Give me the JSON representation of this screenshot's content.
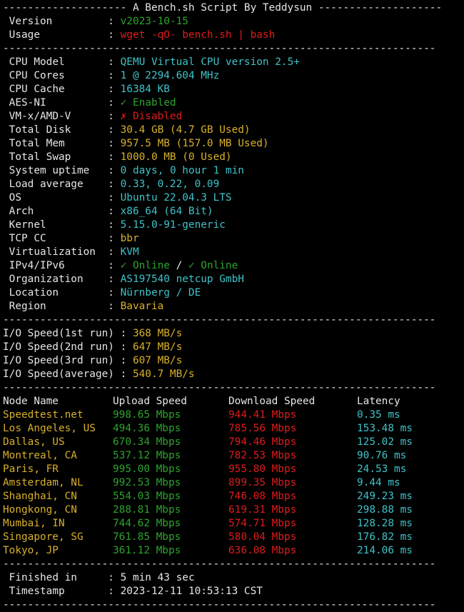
{
  "header": {
    "title": "A Bench.sh Script By Teddysun"
  },
  "info": {
    "version_label": "Version",
    "version_value": "v2023-10-15",
    "usage_label": "Usage",
    "usage_value": "wget -qO- bench.sh | bash"
  },
  "system": [
    {
      "label": "CPU Model",
      "value": "QEMU Virtual CPU version 2.5+",
      "color": "c"
    },
    {
      "label": "CPU Cores",
      "value": "1 @ 2294.604 MHz",
      "color": "c"
    },
    {
      "label": "CPU Cache",
      "value": "16384 KB",
      "color": "c"
    },
    {
      "label": "AES-NI",
      "value": "✓ Enabled",
      "color": "g"
    },
    {
      "label": "VM-x/AMD-V",
      "value": "✗ Disabled",
      "color": "r"
    },
    {
      "label": "Total Disk",
      "value": "30.4 GB (4.7 GB Used)",
      "color": "y"
    },
    {
      "label": "Total Mem",
      "value": "957.5 MB (157.0 MB Used)",
      "color": "y"
    },
    {
      "label": "Total Swap",
      "value": "1000.0 MB (0 Used)",
      "color": "y"
    },
    {
      "label": "System uptime",
      "value": "0 days, 0 hour 1 min",
      "color": "c"
    },
    {
      "label": "Load average",
      "value": "0.33, 0.22, 0.09",
      "color": "c"
    },
    {
      "label": "OS",
      "value": "Ubuntu 22.04.3 LTS",
      "color": "c"
    },
    {
      "label": "Arch",
      "value": "x86_64 (64 Bit)",
      "color": "c"
    },
    {
      "label": "Kernel",
      "value": "5.15.0-91-generic",
      "color": "c"
    },
    {
      "label": "TCP CC",
      "value": "bbr",
      "color": "y"
    },
    {
      "label": "Virtualization",
      "value": "KVM",
      "color": "c"
    }
  ],
  "ip": {
    "label": "IPv4/IPv6",
    "v4": "✓ Online",
    "sep": " / ",
    "v6": "✓ Online"
  },
  "location": [
    {
      "label": "Organization",
      "value": "AS197540 netcup GmbH",
      "color": "c"
    },
    {
      "label": "Location",
      "value": "Nürnberg / DE",
      "color": "c"
    },
    {
      "label": "Region",
      "value": "Bavaria",
      "color": "y"
    }
  ],
  "io": [
    {
      "label": "I/O Speed(1st run)",
      "value": "368 MB/s"
    },
    {
      "label": "I/O Speed(2nd run)",
      "value": "647 MB/s"
    },
    {
      "label": "I/O Speed(3rd run)",
      "value": "607 MB/s"
    },
    {
      "label": "I/O Speed(average)",
      "value": "540.7 MB/s"
    }
  ],
  "speed": {
    "headers": [
      "Node Name",
      "Upload Speed",
      "Download Speed",
      "Latency"
    ],
    "rows": [
      {
        "node": "Speedtest.net",
        "up": "998.65 Mbps",
        "down": "944.41 Mbps",
        "lat": "0.35 ms"
      },
      {
        "node": "Los Angeles, US",
        "up": "494.36 Mbps",
        "down": "785.56 Mbps",
        "lat": "153.48 ms"
      },
      {
        "node": "Dallas, US",
        "up": "670.34 Mbps",
        "down": "794.46 Mbps",
        "lat": "125.02 ms"
      },
      {
        "node": "Montreal, CA",
        "up": "537.12 Mbps",
        "down": "782.53 Mbps",
        "lat": "90.76 ms"
      },
      {
        "node": "Paris, FR",
        "up": "995.00 Mbps",
        "down": "955.80 Mbps",
        "lat": "24.53 ms"
      },
      {
        "node": "Amsterdam, NL",
        "up": "992.53 Mbps",
        "down": "899.35 Mbps",
        "lat": "9.44 ms"
      },
      {
        "node": "Shanghai, CN",
        "up": "554.03 Mbps",
        "down": "746.08 Mbps",
        "lat": "249.23 ms"
      },
      {
        "node": "Hongkong, CN",
        "up": "288.81 Mbps",
        "down": "619.31 Mbps",
        "lat": "298.88 ms"
      },
      {
        "node": "Mumbai, IN",
        "up": "744.62 Mbps",
        "down": "574.71 Mbps",
        "lat": "128.28 ms"
      },
      {
        "node": "Singapore, SG",
        "up": "761.85 Mbps",
        "down": "580.04 Mbps",
        "lat": "176.82 ms"
      },
      {
        "node": "Tokyo, JP",
        "up": "361.12 Mbps",
        "down": "636.08 Mbps",
        "lat": "214.06 ms"
      }
    ]
  },
  "footer": {
    "finished_label": "Finished in",
    "finished_value": "5 min 43 sec",
    "timestamp_label": "Timestamp",
    "timestamp_value": "2023-12-11 10:53:13 CST"
  },
  "colors": {
    "background": "#000000",
    "text": "#e6e6e6",
    "yellow": "#d8b02a",
    "cyan": "#3fc2c8",
    "red": "#e01b1b",
    "green": "#2ea32e"
  }
}
